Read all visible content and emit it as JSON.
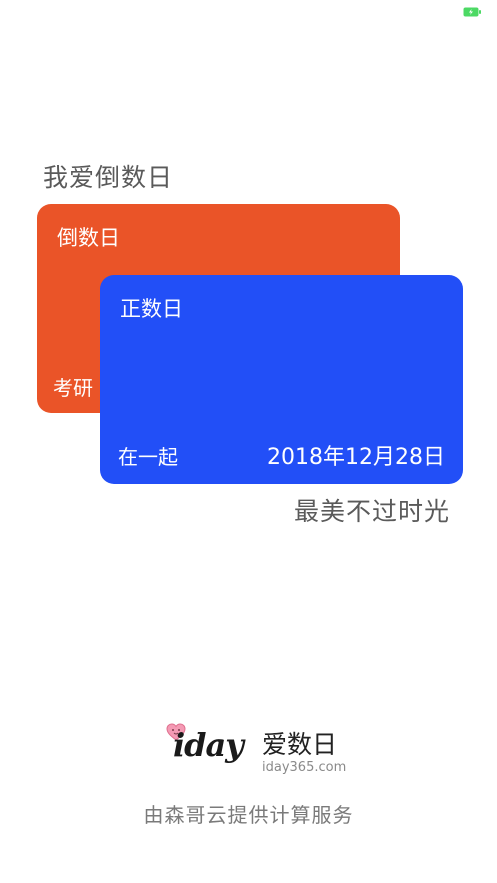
{
  "slogan_top": "我爱倒数日",
  "card_countdown": {
    "title": "倒数日",
    "subtitle": "考研",
    "color": "#ea5428"
  },
  "card_countup": {
    "title": "正数日",
    "subtitle": "在一起",
    "date": "2018年12月28日",
    "color": "#224ff7"
  },
  "slogan_bottom": "最美不过时光",
  "brand": {
    "logo_text": "iday",
    "name": "爱数日",
    "url": "iday365.com"
  },
  "footer": "由森哥云提供计算服务",
  "status_bar": {
    "battery_color": "#4cd964"
  }
}
